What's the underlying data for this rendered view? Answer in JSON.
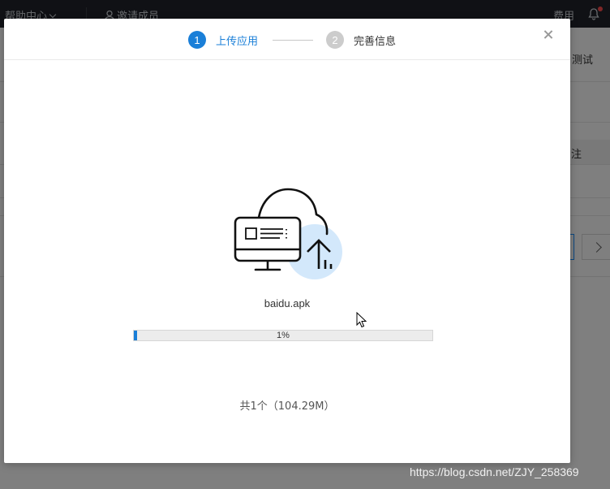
{
  "background": {
    "topbar": {
      "help_label": "帮助中心",
      "invite_label": "邀请成员",
      "fee_label": "费用"
    },
    "right_test_label": "测试",
    "right_note_label": "注"
  },
  "dialog": {
    "steps": [
      {
        "number": "1",
        "label": "上传应用",
        "state": "active"
      },
      {
        "number": "2",
        "label": "完善信息",
        "state": "inactive"
      }
    ],
    "file_name": "baidu.apk",
    "progress": {
      "percent": 1,
      "label": "1%"
    },
    "summary": "共1个（104.29M）"
  },
  "colors": {
    "accent": "#1a7fd8",
    "step_inactive": "#cccccc",
    "topbar": "#20232a"
  },
  "watermark": "https://blog.csdn.net/ZJY_258369"
}
